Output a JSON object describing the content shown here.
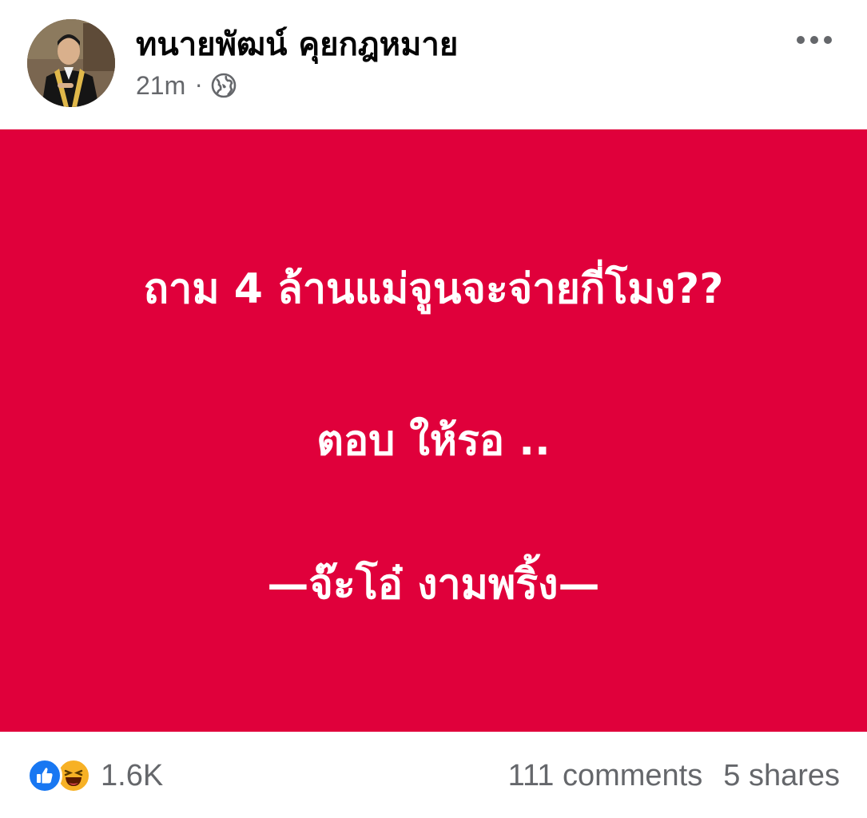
{
  "post": {
    "author": "ทนายพัฒน์ คุยกฎหมาย",
    "time": "21m",
    "separator": "·",
    "privacy_icon": "globe-icon",
    "more_icon": "more-dots-icon"
  },
  "banner": {
    "background": "#e0003b",
    "text_color": "#ffffff",
    "line1": "ถาม 4 ล้านแม่จูนจะจ่ายกี่โมง??",
    "line2": "ตอบ ให้รอ ..",
    "line3": "—จ๊ะโอ๋ งามพริ้ง—"
  },
  "footer": {
    "reaction_icons": [
      "like-icon",
      "haha-icon"
    ],
    "reaction_count": "1.6K",
    "comments": "111 comments",
    "shares": "5 shares"
  },
  "colors": {
    "like_blue": "#1877f2",
    "haha_yellow": "#f7b125",
    "meta_gray": "#65676b"
  }
}
